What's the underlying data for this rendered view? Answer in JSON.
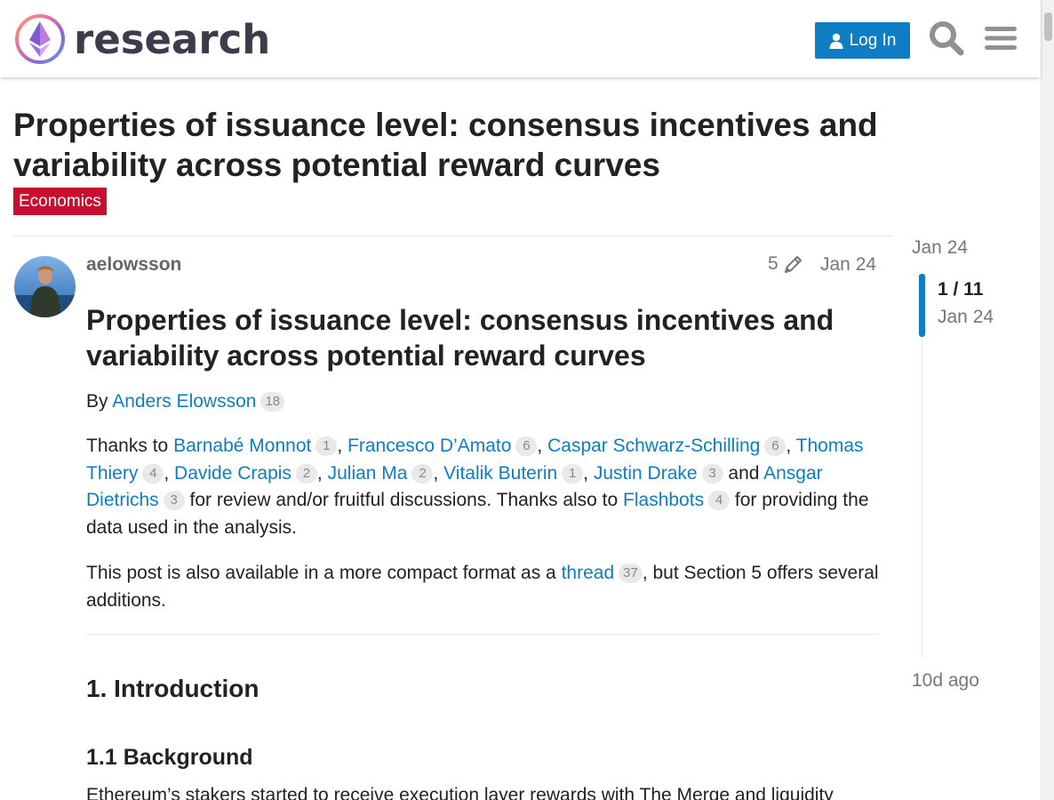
{
  "header": {
    "logo_text": "research",
    "login_label": "Log In"
  },
  "topic": {
    "title": "Properties of issuance level: consensus incentives and variability across potential reward curves",
    "category": "Economics",
    "category_color": "#c8102e"
  },
  "post": {
    "username": "aelowsson",
    "edit_count": "5",
    "date": "Jan 24",
    "heading": "Properties of issuance level: consensus incentives and variability across potential reward curves",
    "byline": {
      "prefix": "By ",
      "author": "Anders Elowsson",
      "author_count": "18"
    },
    "thanks": {
      "prefix": "Thanks to ",
      "people": [
        {
          "name": "Barnabé Monnot",
          "count": "1",
          "sep": ", "
        },
        {
          "name": "Francesco D’Amato",
          "count": "6",
          "sep": ", "
        },
        {
          "name": "Caspar Schwarz-Schilling",
          "count": "6",
          "sep": ", "
        },
        {
          "name": "Thomas Thiery",
          "count": "4",
          "sep": ", "
        },
        {
          "name": "Davide Crapis",
          "count": "2",
          "sep": ", "
        },
        {
          "name": "Julian Ma",
          "count": "2",
          "sep": ", "
        },
        {
          "name": "Vitalik Buterin",
          "count": "1",
          "sep": ", "
        },
        {
          "name": "Justin Drake",
          "count": "3",
          "sep": " and "
        },
        {
          "name": "Ansgar Dietrichs",
          "count": "3",
          "sep": ""
        }
      ],
      "middle": " for review and/or fruitful discussions. Thanks also to ",
      "org": "Flashbots",
      "org_count": "4",
      "suffix": " for providing the data used in the analysis."
    },
    "compact": {
      "prefix": "This post is also available in a more compact format as a ",
      "link": "thread",
      "count": "37",
      "suffix": ", but Section 5 offers several additions."
    },
    "section_1": "1. Introduction",
    "section_1_1": "1.1 Background",
    "last_line": "Ethereum’s stakers started to receive execution layer rewards with The Merge and liquidity"
  },
  "timeline": {
    "top_date": "Jan 24",
    "position": "1 / 11",
    "handle_date": "Jan 24",
    "bottom_date": "10d ago"
  },
  "colors": {
    "link": "#0f7dc4",
    "accent": "#0f7dc4"
  }
}
